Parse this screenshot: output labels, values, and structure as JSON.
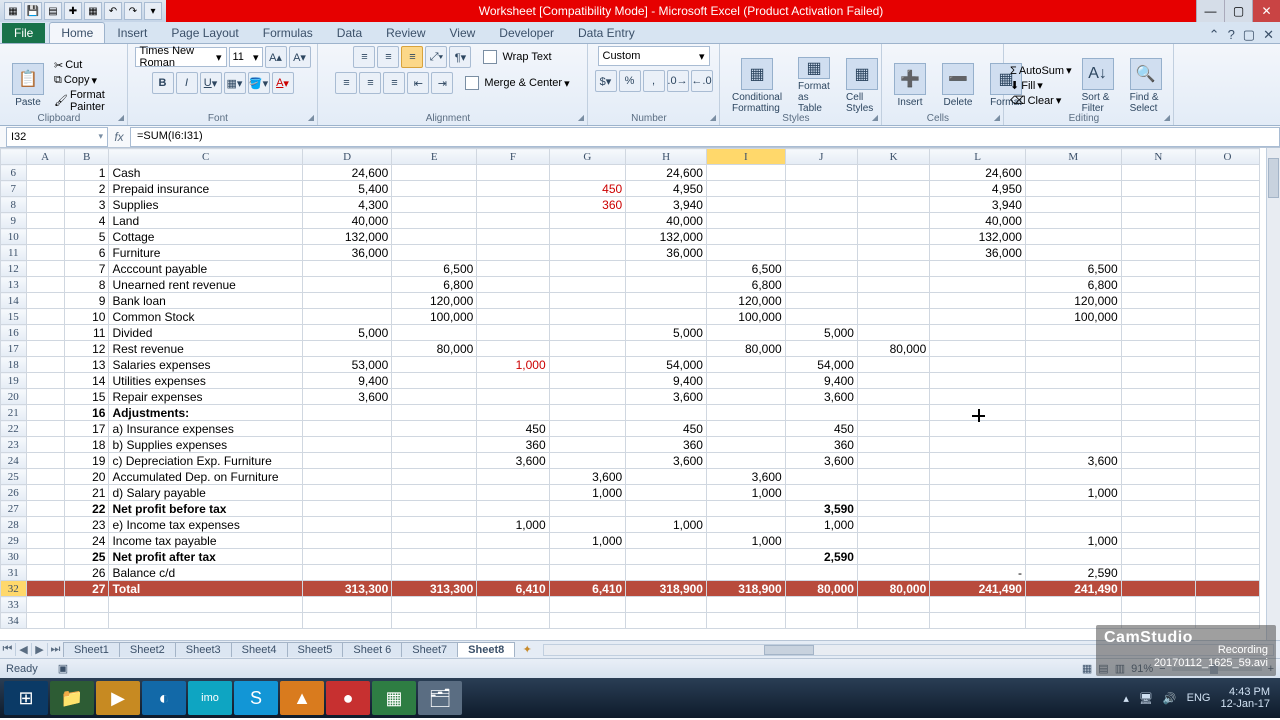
{
  "title": "Worksheet  [Compatibility Mode]  -  Microsoft Excel  (Product Activation Failed)",
  "tabs": [
    "File",
    "Home",
    "Insert",
    "Page Layout",
    "Formulas",
    "Data",
    "Review",
    "View",
    "Developer",
    "Data Entry"
  ],
  "active_tab": "Home",
  "clipboard": {
    "paste": "Paste",
    "cut": "Cut",
    "copy": "Copy",
    "fp": "Format Painter",
    "label": "Clipboard"
  },
  "font": {
    "name": "Times New Roman",
    "size": "11",
    "label": "Font"
  },
  "alignment": {
    "wrap": "Wrap Text",
    "merge": "Merge & Center",
    "label": "Alignment"
  },
  "number": {
    "format": "Custom",
    "label": "Number"
  },
  "styles": {
    "cf": "Conditional Formatting",
    "fat": "Format as Table",
    "cs": "Cell Styles",
    "label": "Styles"
  },
  "cells": {
    "insert": "Insert",
    "delete": "Delete",
    "format": "Format",
    "label": "Cells"
  },
  "editing": {
    "autosum": "AutoSum",
    "fill": "Fill",
    "clear": "Clear",
    "sort": "Sort & Filter",
    "find": "Find & Select",
    "label": "Editing"
  },
  "namebox": "I32",
  "formula": "=SUM(I6:I31)",
  "columns": [
    "A",
    "B",
    "C",
    "D",
    "E",
    "F",
    "G",
    "H",
    "I",
    "J",
    "K",
    "L",
    "M",
    "N",
    "O"
  ],
  "rows": [
    {
      "r": 6,
      "b": "1",
      "c": "Cash",
      "d": "24,600",
      "h": "24,600",
      "l": "24,600"
    },
    {
      "r": 7,
      "b": "2",
      "c": "Prepaid insurance",
      "d": "5,400",
      "g": "450",
      "gred": true,
      "h": "4,950",
      "l": "4,950"
    },
    {
      "r": 8,
      "b": "3",
      "c": "Supplies",
      "d": "4,300",
      "g": "360",
      "gred": true,
      "h": "3,940",
      "l": "3,940"
    },
    {
      "r": 9,
      "b": "4",
      "c": "Land",
      "d": "40,000",
      "h": "40,000",
      "l": "40,000"
    },
    {
      "r": 10,
      "b": "5",
      "c": "Cottage",
      "d": "132,000",
      "h": "132,000",
      "l": "132,000"
    },
    {
      "r": 11,
      "b": "6",
      "c": "Furniture",
      "d": "36,000",
      "h": "36,000",
      "l": "36,000"
    },
    {
      "r": 12,
      "b": "7",
      "c": "Acccount payable",
      "e": "6,500",
      "i": "6,500",
      "m": "6,500"
    },
    {
      "r": 13,
      "b": "8",
      "c": "Unearned rent revenue",
      "e": "6,800",
      "i": "6,800",
      "m": "6,800"
    },
    {
      "r": 14,
      "b": "9",
      "c": "Bank loan",
      "e": "120,000",
      "i": "120,000",
      "m": "120,000"
    },
    {
      "r": 15,
      "b": "10",
      "c": "Common Stock",
      "e": "100,000",
      "i": "100,000",
      "m": "100,000"
    },
    {
      "r": 16,
      "b": "11",
      "c": "Divided",
      "d": "5,000",
      "h": "5,000",
      "j": "5,000"
    },
    {
      "r": 17,
      "b": "12",
      "c": "Rest revenue",
      "e": "80,000",
      "i": "80,000",
      "k": "80,000"
    },
    {
      "r": 18,
      "b": "13",
      "c": "Salaries expenses",
      "d": "53,000",
      "f": "1,000",
      "fred": true,
      "h": "54,000",
      "j": "54,000"
    },
    {
      "r": 19,
      "b": "14",
      "c": "Utilities expenses",
      "d": "9,400",
      "h": "9,400",
      "j": "9,400"
    },
    {
      "r": 20,
      "b": "15",
      "c": "Repair expenses",
      "d": "3,600",
      "h": "3,600",
      "j": "3,600"
    },
    {
      "r": 21,
      "b": "16",
      "c": "Adjustments:",
      "bold": true
    },
    {
      "r": 22,
      "b": "17",
      "c": "a) Insurance expenses",
      "f": "450",
      "h": "450",
      "j": "450"
    },
    {
      "r": 23,
      "b": "18",
      "c": "b) Supplies expenses",
      "f": "360",
      "h": "360",
      "j": "360"
    },
    {
      "r": 24,
      "b": "19",
      "c": "c) Depreciation Exp.  Furniture",
      "f": "3,600",
      "h": "3,600",
      "j": "3,600",
      "m": "3,600"
    },
    {
      "r": 25,
      "b": "20",
      "c": "   Accumulated Dep. on Furniture",
      "g": "3,600",
      "i": "3,600"
    },
    {
      "r": 26,
      "b": "21",
      "c": "d) Salary payable",
      "g": "1,000",
      "i": "1,000",
      "m": "1,000"
    },
    {
      "r": 27,
      "b": "22",
      "c": "Net profit before tax",
      "bold": true,
      "j": "3,590"
    },
    {
      "r": 28,
      "b": "23",
      "c": "e) Income tax expenses",
      "f": "1,000",
      "h": "1,000",
      "j": "1,000"
    },
    {
      "r": 29,
      "b": "24",
      "c": "    Income tax payable",
      "g": "1,000",
      "i": "1,000",
      "m": "1,000"
    },
    {
      "r": 30,
      "b": "25",
      "c": "Net profit after tax",
      "bold": true,
      "j": "2,590"
    },
    {
      "r": 31,
      "b": "26",
      "c": "Balance c/d",
      "l": "-",
      "m": "2,590"
    },
    {
      "r": 32,
      "b": "27",
      "c": "Total",
      "total": true,
      "d": "313,300",
      "e": "313,300",
      "f": "6,410",
      "g": "6,410",
      "h": "318,900",
      "i": "318,900",
      "j": "80,000",
      "k": "80,000",
      "l": "241,490",
      "m": "241,490"
    },
    {
      "r": 33
    },
    {
      "r": 34
    }
  ],
  "sheets": [
    "Sheet1",
    "Sheet2",
    "Sheet3",
    "Sheet4",
    "Sheet5",
    "Sheet 6",
    "Sheet7",
    "Sheet8"
  ],
  "active_sheet": "Sheet8",
  "status": "Ready",
  "zoom": "91%",
  "lang": "ENG",
  "time": "4:43 PM",
  "date": "12-Jan-17",
  "camstudio": {
    "name": "CamStudio",
    "rec": "Recording  20170112_1625_59.avi"
  }
}
